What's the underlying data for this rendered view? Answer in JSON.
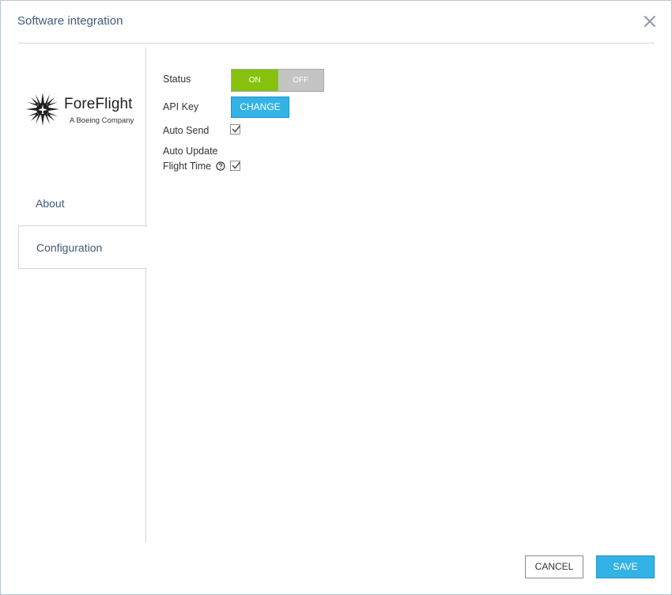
{
  "dialog": {
    "title": "Software integration"
  },
  "logo": {
    "name": "ForeFlight",
    "subtitle": "A Boeing Company"
  },
  "nav": {
    "items": [
      {
        "label": "About",
        "selected": false
      },
      {
        "label": "Configuration",
        "selected": true
      }
    ]
  },
  "config": {
    "status_label": "Status",
    "toggle_on_label": "ON",
    "toggle_off_label": "OFF",
    "api_key_label": "API Key",
    "change_label": "CHANGE",
    "auto_send_label": "Auto Send",
    "auto_update_label_line1": "Auto Update",
    "auto_update_label_line2": "Flight Time",
    "auto_send_checked": true,
    "auto_update_checked": true
  },
  "footer": {
    "cancel_label": "CANCEL",
    "save_label": "SAVE"
  },
  "colors": {
    "title": "#3e5a78",
    "toggle_on": "#86c20d",
    "toggle_off": "#c4c4c4",
    "primary_button": "#33b2e5"
  }
}
